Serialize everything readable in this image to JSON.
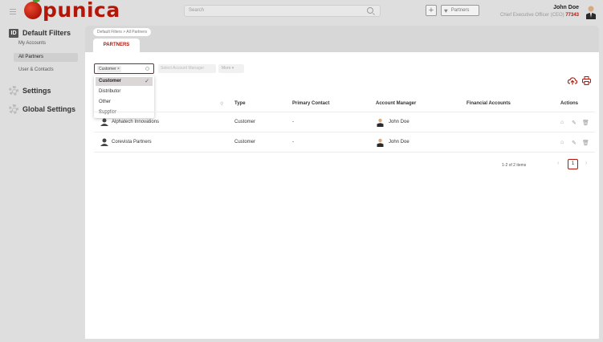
{
  "app": {
    "logo_text": "punica"
  },
  "search": {
    "placeholder": "Search"
  },
  "header": {
    "add_symbol": "+",
    "partners_label": "Partners",
    "user_name": "John Doe",
    "user_role": "Chief Executive Officer (CEO)",
    "user_code": "77343"
  },
  "sidebar": {
    "default_filters": "Default Filters",
    "items": [
      {
        "label": "My Accounts"
      },
      {
        "label": "All Partners"
      },
      {
        "label": "User & Contacts"
      }
    ],
    "settings": "Settings",
    "global_settings": "Global Settings"
  },
  "breadcrumb": "Default Filters > All Partners",
  "tab": "PARTNERS",
  "filters": {
    "type_chip": "Customer ×",
    "account_manager_placeholder": "Select Account Manager",
    "more_label": "More ▾",
    "dropdown_options": [
      {
        "label": "Customer"
      },
      {
        "label": "Distributor"
      },
      {
        "label": "Other"
      },
      {
        "label": "Supplier"
      }
    ]
  },
  "table": {
    "headers": {
      "type": "Type",
      "primary_contact": "Primary Contact",
      "account_manager": "Account Manager",
      "financial_accounts": "Financial Accounts",
      "actions": "Actions"
    },
    "rows": [
      {
        "name": "Alphatech Innovations",
        "type": "Customer",
        "primary_contact": "-",
        "account_manager": "John Doe"
      },
      {
        "name": "Corevista Partners",
        "type": "Customer",
        "primary_contact": "-",
        "account_manager": "John Doe"
      }
    ]
  },
  "pagination": {
    "summary": "1-2 of 2 items",
    "current_page": "1"
  },
  "colors": {
    "accent": "#b3170a",
    "background": "#dedede"
  }
}
